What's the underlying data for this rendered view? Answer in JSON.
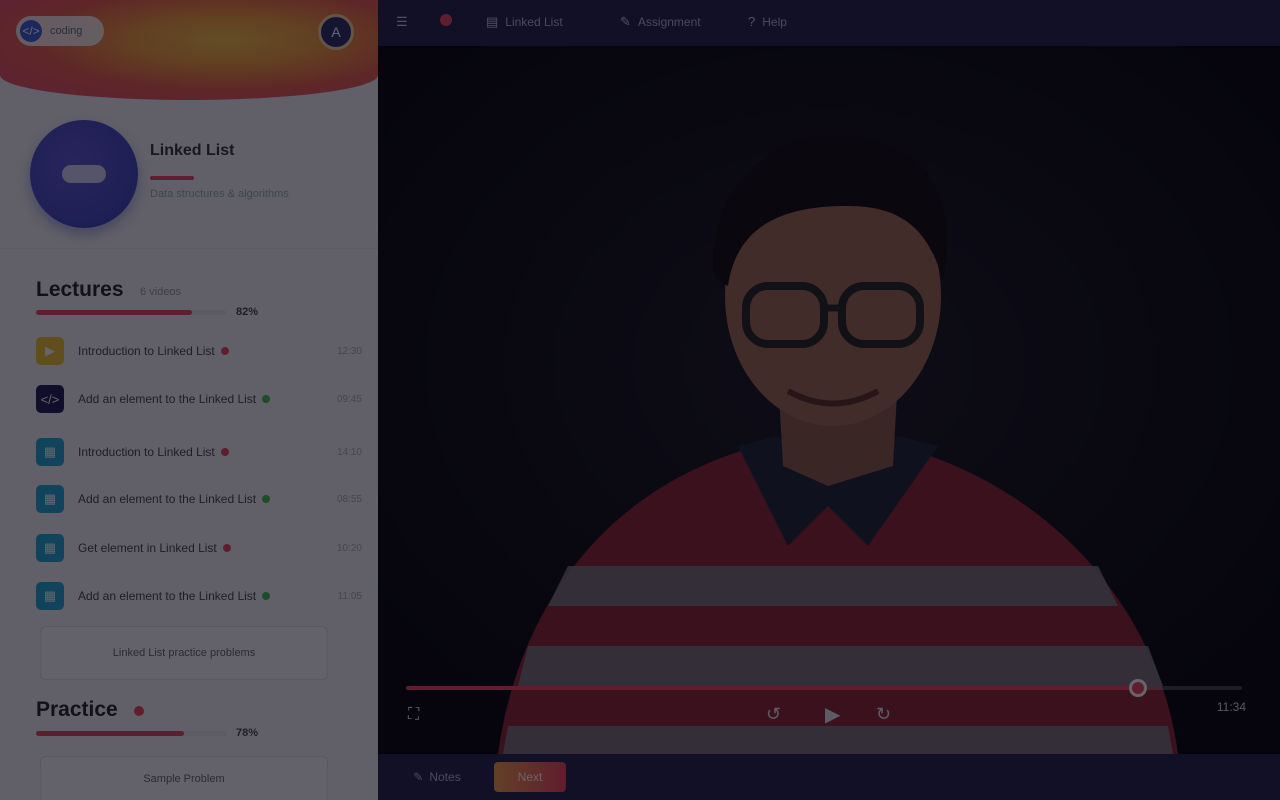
{
  "brand": {
    "name": "coding"
  },
  "user": {
    "initial": "A"
  },
  "course": {
    "title": "Linked List",
    "subtitle": "Data structures & algorithms"
  },
  "lectures": {
    "title": "Lectures",
    "count": "6 videos",
    "progress_pct": 0.82,
    "progress_label": "82%",
    "items": [
      {
        "title": "Introduction to Linked List",
        "duration": "12:30",
        "icon": "play-icon",
        "icon_color": "#f2c230",
        "status_color": "#f0425c"
      },
      {
        "title": "Add an element to the Linked List",
        "duration": "09:45",
        "icon": "code-icon",
        "icon_color": "#1d1b52",
        "status_color": "#3fbf4f"
      },
      {
        "title": "Introduction to Linked List",
        "duration": "14:10",
        "icon": "doc-icon",
        "icon_color": "#24a5d8",
        "status_color": "#f0425c"
      },
      {
        "title": "Add an element to the Linked List",
        "duration": "08:55",
        "icon": "doc-icon",
        "icon_color": "#24a5d8",
        "status_color": "#3fbf4f"
      },
      {
        "title": "Get element in Linked List",
        "duration": "10:20",
        "icon": "doc-icon",
        "icon_color": "#24a5d8",
        "status_color": "#f0425c"
      },
      {
        "title": "Add an element to the Linked List",
        "duration": "11:05",
        "icon": "doc-icon",
        "icon_color": "#24a5d8",
        "status_color": "#3fbf4f"
      }
    ],
    "next_card_label": "Linked List practice problems"
  },
  "practice": {
    "title": "Practice",
    "progress_pct": 0.78,
    "progress_label": "78%",
    "card_label": "Sample Problem"
  },
  "topbar": {
    "items": [
      {
        "label": "Linked List",
        "icon": "list-icon"
      },
      {
        "label": "Assignment",
        "icon": "edit-icon"
      },
      {
        "label": "Help",
        "icon": "help-icon"
      }
    ]
  },
  "player": {
    "progress_pct": 0.875,
    "time": "11:34",
    "accent": "#f0425c"
  },
  "bottombar": {
    "notes_label": "Notes",
    "next_label": "Next"
  }
}
